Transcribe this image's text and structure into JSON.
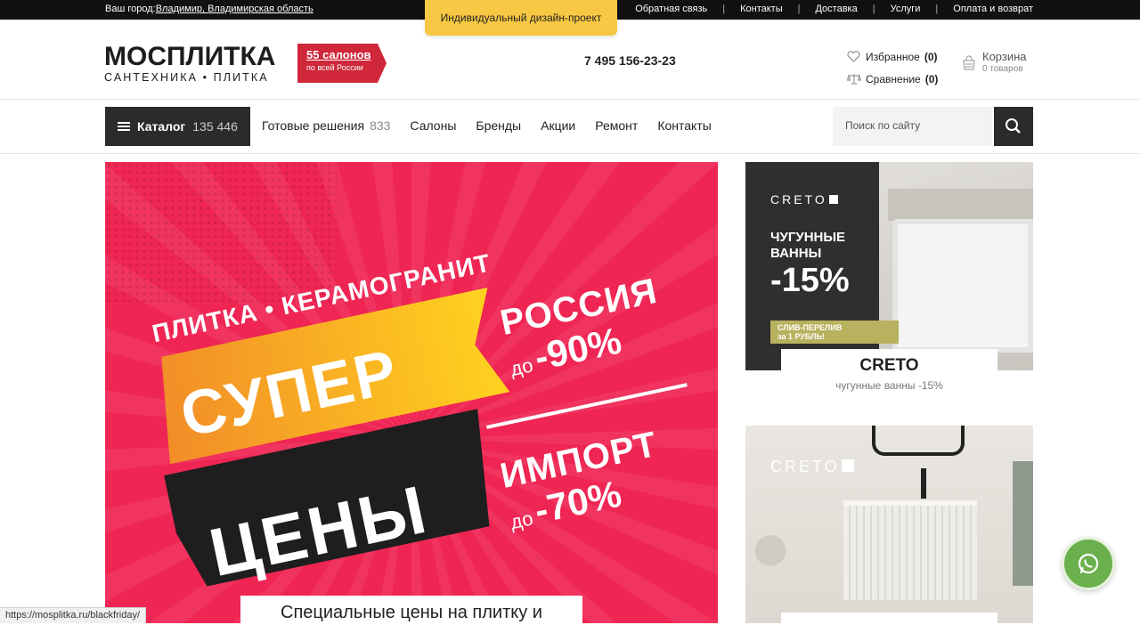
{
  "topbar": {
    "city_label": "Ваш город:",
    "city_value": "Владимир, Владимирская область",
    "design_project": "Индивидуальный дизайн-проект",
    "links": [
      "Обратная связь",
      "Контакты",
      "Доставка",
      "Услуги",
      "Оплата и возврат"
    ]
  },
  "header": {
    "logo_main": "МОСПЛИТКА",
    "logo_sub": "САНТЕХНИКА • ПЛИТКА",
    "salons_count": "55 салонов",
    "salons_note": "по всей России",
    "phone": "7 495 156-23-23",
    "favorites_label": "Избранное",
    "favorites_count": "(0)",
    "compare_label": "Сравнение",
    "compare_count": "(0)",
    "cart_label": "Корзина",
    "cart_items": "0 товаров"
  },
  "nav": {
    "catalog_label": "Каталог",
    "catalog_count": "135 446",
    "ready_label": "Готовые решения",
    "ready_count": "833",
    "items": [
      "Салоны",
      "Бренды",
      "Акции",
      "Ремонт",
      "Контакты"
    ],
    "search_placeholder": "Поиск по сайту"
  },
  "banner": {
    "line1": "ПЛИТКА • КЕРАМОГРАНИТ",
    "super": "СУПЕР",
    "prices": "ЦЕНЫ",
    "russia": "РОССИЯ",
    "russia_prefix": "до",
    "russia_pct": "-90%",
    "import": "ИМПОРТ",
    "import_prefix": "до",
    "import_pct": "-70%",
    "caption": "Специальные цены на плитку и"
  },
  "side_cards": [
    {
      "brand": "CRETO",
      "promo_line1": "ЧУГУННЫЕ",
      "promo_line2": "ВАННЫ",
      "promo_pct": "-15%",
      "plate_line1": "СЛИВ-ПЕРЕЛИВ",
      "plate_line2": "за 1 РУБЛЬ!",
      "title": "CRETO",
      "subtitle": "чугунные ванны -15%"
    },
    {
      "brand": "CRETO"
    }
  ],
  "status_url": "https://mosplitka.ru/blackfriday/",
  "colors": {
    "accent_red": "#d0273a",
    "banner_pink": "#ef2553",
    "design_yellow": "#f7c843",
    "whatsapp_green": "#6ab04c"
  }
}
